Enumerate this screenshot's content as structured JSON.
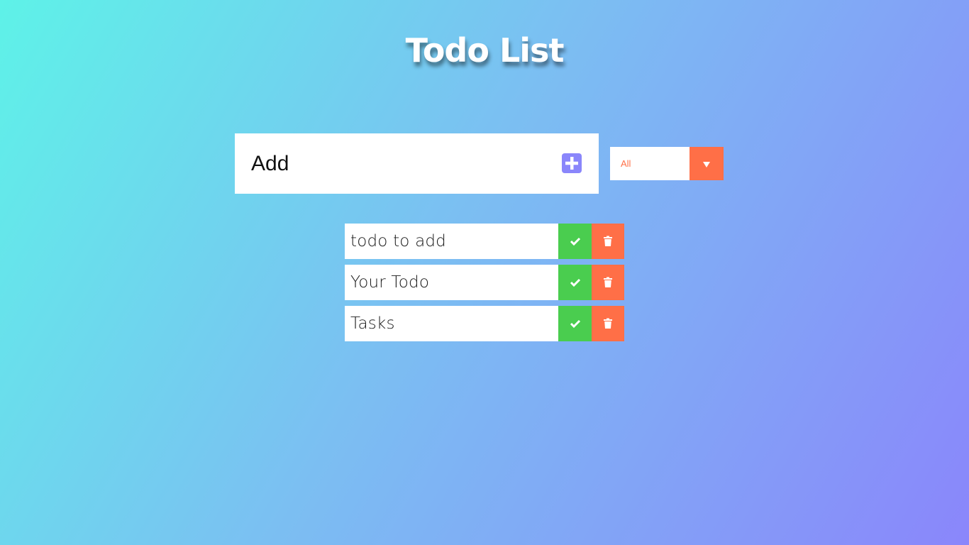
{
  "header": {
    "title": "Todo List"
  },
  "add_form": {
    "input_value": "Add",
    "add_button_icon": "plus-square-icon"
  },
  "filter": {
    "selected": "All",
    "dropdown_icon": "caret-down-icon"
  },
  "todos": [
    {
      "text": "todo to add"
    },
    {
      "text": "Your Todo"
    },
    {
      "text": "Tasks"
    }
  ],
  "colors": {
    "background_start": "#5ef2e8",
    "background_end": "#8a86fb",
    "accent_purple": "#8a86fb",
    "complete_green": "#4acd4f",
    "delete_orange": "#ff6f47"
  }
}
